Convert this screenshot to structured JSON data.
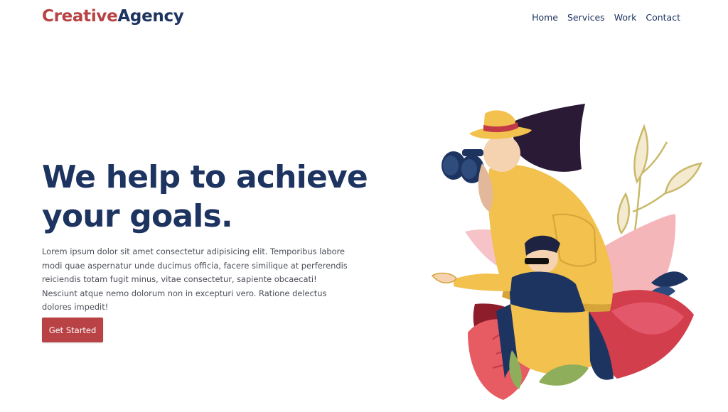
{
  "brand": {
    "part1": "Creative",
    "part2": "Agency",
    "accent_color": "#b84244",
    "primary_color": "#1d3461"
  },
  "nav": {
    "items": [
      {
        "label": "Home"
      },
      {
        "label": "Services"
      },
      {
        "label": "Work"
      },
      {
        "label": "Contact"
      }
    ]
  },
  "hero": {
    "title_line1": "We help to achieve",
    "title_line2": "your goals.",
    "description": "Lorem ipsum dolor sit amet consectetur adipisicing elit. Temporibus labore modi quae aspernatur unde ducimus officia, facere similique at perferendis reiciendis totam fugit minus, vitae consectetur, sapiente obcaecati! Nesciunt atque nemo dolorum non in excepturi vero. Ratione delectus dolores impedit!",
    "cta_label": "Get Started"
  },
  "illustration": {
    "icon": "explorers-with-binoculars-illustration"
  }
}
